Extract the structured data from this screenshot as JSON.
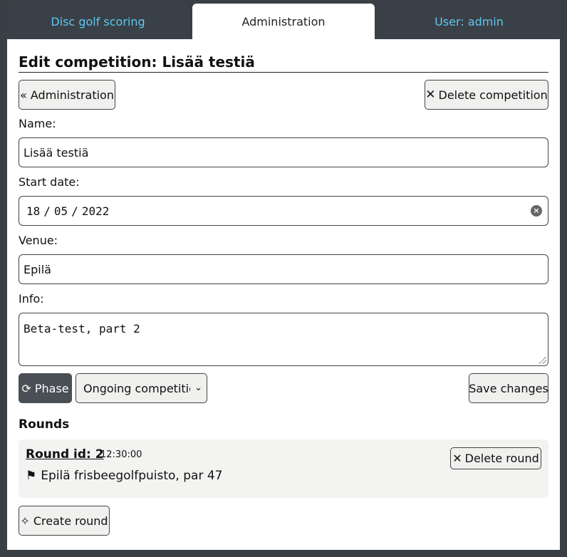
{
  "tabs": {
    "scoring": "Disc golf scoring",
    "administration": "Administration",
    "user": "User: admin"
  },
  "page": {
    "title": "Edit competition: Lisää testiä",
    "back_button": "« Administration",
    "delete_button": "Delete competition"
  },
  "form": {
    "name_label": "Name:",
    "name_value": "Lisää testiä",
    "date_label": "Start date:",
    "date_day": "18",
    "date_month": "05",
    "date_year": "2022",
    "venue_label": "Venue:",
    "venue_value": "Epilä",
    "info_label": "Info:",
    "info_value": "Beta-test, part 2",
    "phase_button": "⟳ Phase",
    "phase_select_value": "Ongoing competition",
    "save_button": "Save changes"
  },
  "rounds": {
    "heading": "Rounds",
    "items": [
      {
        "id_label": "Round id: 2",
        "time": "12:30:00",
        "venue": "Epilä frisbeegolfpuisto, par 47",
        "delete_label": "Delete round"
      }
    ],
    "create_button": "✧ Create round"
  }
}
